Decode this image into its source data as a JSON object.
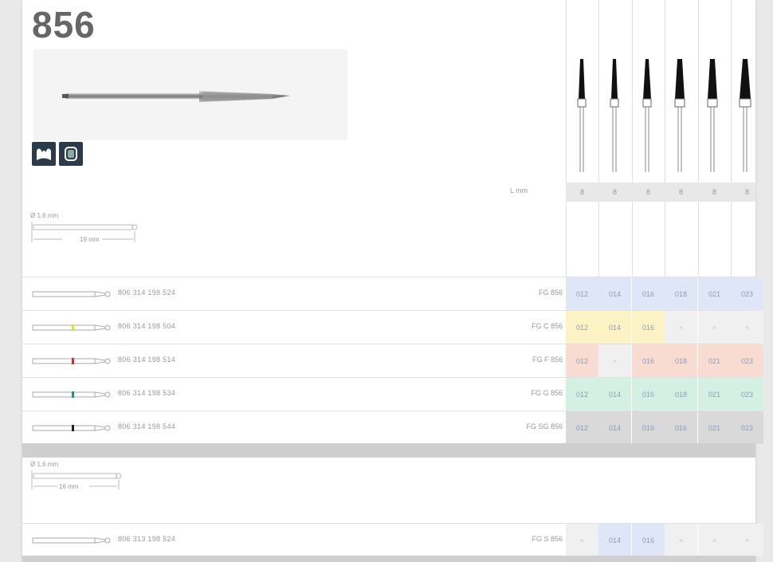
{
  "header": {
    "title": "856"
  },
  "lengths": {
    "label": "L mm",
    "values": [
      "8",
      "8",
      "8",
      "8",
      "8",
      "8"
    ]
  },
  "dims_top": {
    "diameter": "Ø 1,6 mm",
    "length": "19 mm"
  },
  "dims_bottom": {
    "diameter": "Ø 1,6 mm",
    "length": "16 mm"
  },
  "rows": [
    {
      "code": "806 314 198 524",
      "name": "FG 856",
      "stripe": "",
      "color": "#dfe6f8",
      "cells": [
        "012",
        "014",
        "016",
        "018",
        "021",
        "023"
      ]
    },
    {
      "code": "806 314 198 504",
      "name": "FG C 856",
      "stripe": "#e0e030",
      "color": "#fbf3c4",
      "cells": [
        "012",
        "014",
        "016",
        "×",
        "×",
        "×"
      ]
    },
    {
      "code": "806 314 198 514",
      "name": "FG F 856",
      "stripe": "#d23030",
      "color": "#f8dcd2",
      "cells": [
        "012",
        "×",
        "016",
        "018",
        "021",
        "023"
      ]
    },
    {
      "code": "806 314 198 534",
      "name": "FG G 856",
      "stripe": "#1e9a72",
      "color": "#d3f0e2",
      "cells": [
        "012",
        "014",
        "016",
        "018",
        "021",
        "023"
      ]
    },
    {
      "code": "806 314 198 544",
      "name": "FG SG 856",
      "stripe": "#222222",
      "color": "#d9d9d9",
      "cells": [
        "012",
        "014",
        "016",
        "016",
        "021",
        "023"
      ]
    }
  ],
  "row_bottom": {
    "code": "806 313 198 524",
    "name": "FG S 856",
    "stripe": "",
    "color": "#dfe6f8",
    "cells": [
      "×",
      "014",
      "016",
      "×",
      "×",
      "×"
    ]
  },
  "colors": {
    "sheet": "#ffffff",
    "background": "#e9e9e9",
    "separator": "#cfcfcf",
    "blue": "#dfe6f8",
    "yellow": "#fbf3c4",
    "red": "#f8dcd2",
    "green": "#d3f0e2",
    "gray": "#d9d9d9"
  },
  "icons": [
    "crown-prep-icon",
    "veneer-prep-icon"
  ]
}
